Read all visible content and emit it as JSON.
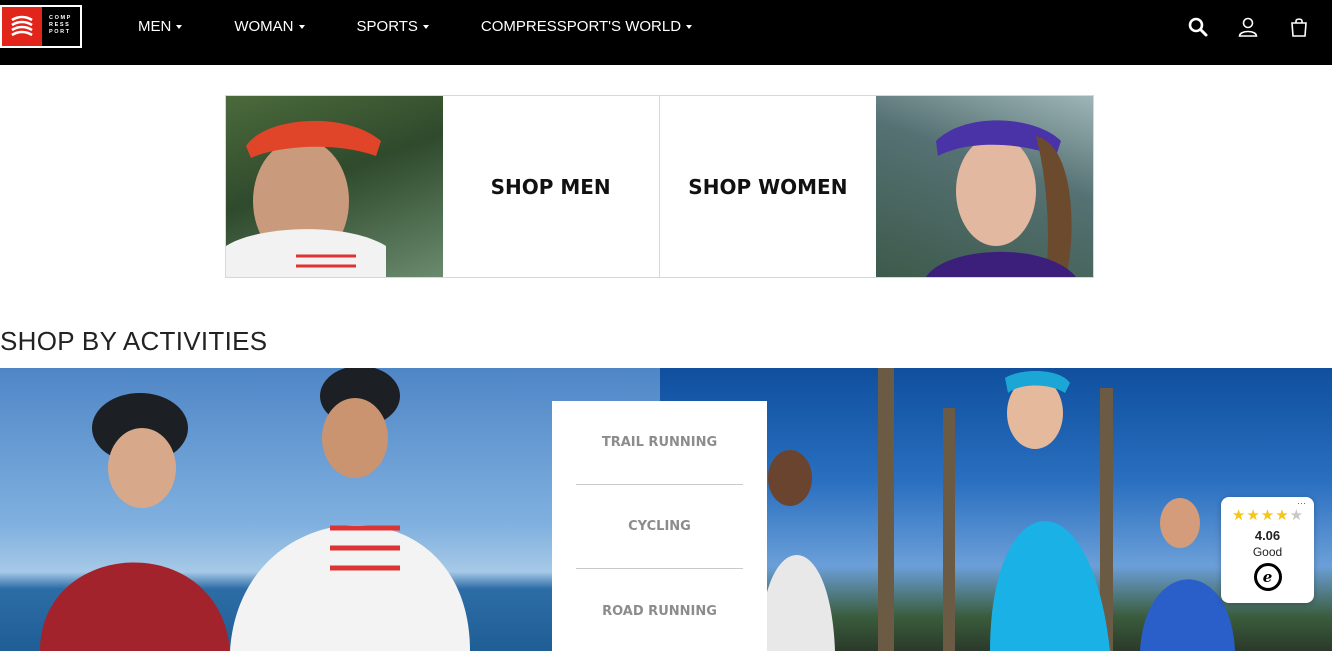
{
  "brand": {
    "logo_lines": [
      "COMP",
      "RESS",
      "PORT"
    ],
    "logo_color": "#e1251b"
  },
  "nav": {
    "items": [
      {
        "label": "MEN"
      },
      {
        "label": "WOMAN"
      },
      {
        "label": "SPORTS"
      },
      {
        "label": "COMPRESSPORT'S WORLD"
      }
    ],
    "icons": [
      "search-icon",
      "account-icon",
      "shopping-bag-icon"
    ]
  },
  "shop": {
    "men_label": "SHOP MEN",
    "women_label": "SHOP WOMEN"
  },
  "activities": {
    "title": "SHOP BY ACTIVITIES",
    "items": [
      {
        "label": "TRAIL RUNNING"
      },
      {
        "label": "CYCLING"
      },
      {
        "label": "ROAD RUNNING"
      }
    ]
  },
  "rating": {
    "value": "4.06",
    "label": "Good",
    "stars_filled": 4,
    "stars_total": 5,
    "badge_letter": "e",
    "menu_glyph": "···",
    "star_color": "#f5c518"
  },
  "colors": {
    "header_bg": "#000000",
    "text_dark": "#111111",
    "activity_text": "#8c8c8c"
  }
}
